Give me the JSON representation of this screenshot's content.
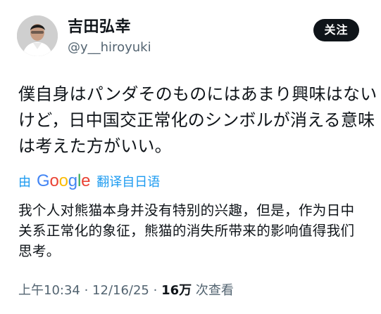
{
  "user": {
    "display_name": "吉田弘幸",
    "handle": "@y__hiroyuki",
    "follow_label": "关注"
  },
  "tweet": {
    "lines": [
      "僕自身はパンダそのものにはあまり興味はない",
      "けど，日中国交正常化のシンボルが消える意味",
      "は考えた方がいい。"
    ]
  },
  "translation": {
    "prefix": "由",
    "brand": "Google",
    "suffix": "翻译自日语",
    "lines": [
      "我个人对熊猫本身并没有特别的兴趣，但是，作为日中",
      "关系正常化的象征，熊猫的消失所带来的影响值得我们",
      "思考。"
    ]
  },
  "meta": {
    "time": "上午10:34",
    "separator1": " · ",
    "date": "12/16/25",
    "separator2": " · ",
    "views": "16万",
    "views_label": " 次查看"
  },
  "colors": {
    "text": "#0f1419",
    "muted": "#536471",
    "link": "#1d9bf0",
    "button_bg": "#0f1419",
    "google_blue": "#4285f4",
    "google_red": "#ea4335",
    "google_yellow": "#fbbc05",
    "google_green": "#34a853"
  }
}
